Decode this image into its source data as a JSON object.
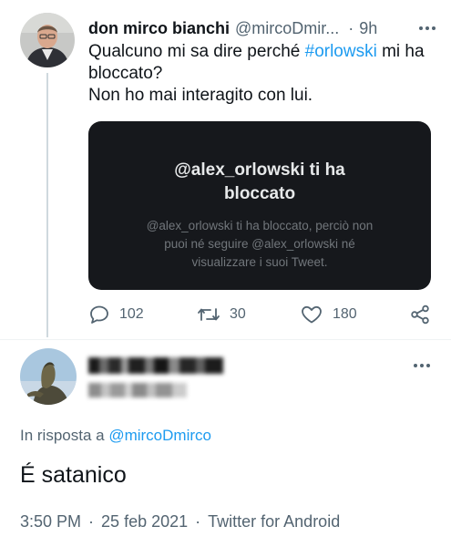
{
  "parent_tweet": {
    "author_name": "don mirco bianchi",
    "author_handle": "@mircoDmir...",
    "separator": "·",
    "time": "9h",
    "text_lines": [
      {
        "before": "Qualcuno mi sa dire perché ",
        "hashtag": "#orlowski",
        "after": " mi ha"
      },
      {
        "text": "bloccato?"
      },
      {
        "text": "Non ho mai interagito con lui."
      }
    ],
    "card": {
      "title_line1": "@alex_orlowski ti ha",
      "title_line2": "bloccato",
      "body_line1": "@alex_orlowski ti ha bloccato, perciò non",
      "body_line2": "puoi né seguire @alex_orlowski né",
      "body_line3": "visualizzare i suoi Tweet."
    },
    "actions": {
      "replies": "102",
      "retweets": "30",
      "likes": "180"
    }
  },
  "reply_tweet": {
    "in_reply_prefix": "In risposta a ",
    "in_reply_mention": "@mircoDmirco",
    "text": "É satanico",
    "time": "3:50 PM",
    "date": "25 feb 2021",
    "source": "Twitter for Android",
    "separator": "·"
  },
  "icons": {
    "more": "more-dots-icon",
    "reply": "reply-icon",
    "retweet": "retweet-icon",
    "like": "like-icon",
    "share": "share-icon"
  },
  "colors": {
    "accent": "#1d9bf0",
    "text": "#0f1419",
    "secondary": "#536471",
    "card_bg": "#16181c"
  }
}
